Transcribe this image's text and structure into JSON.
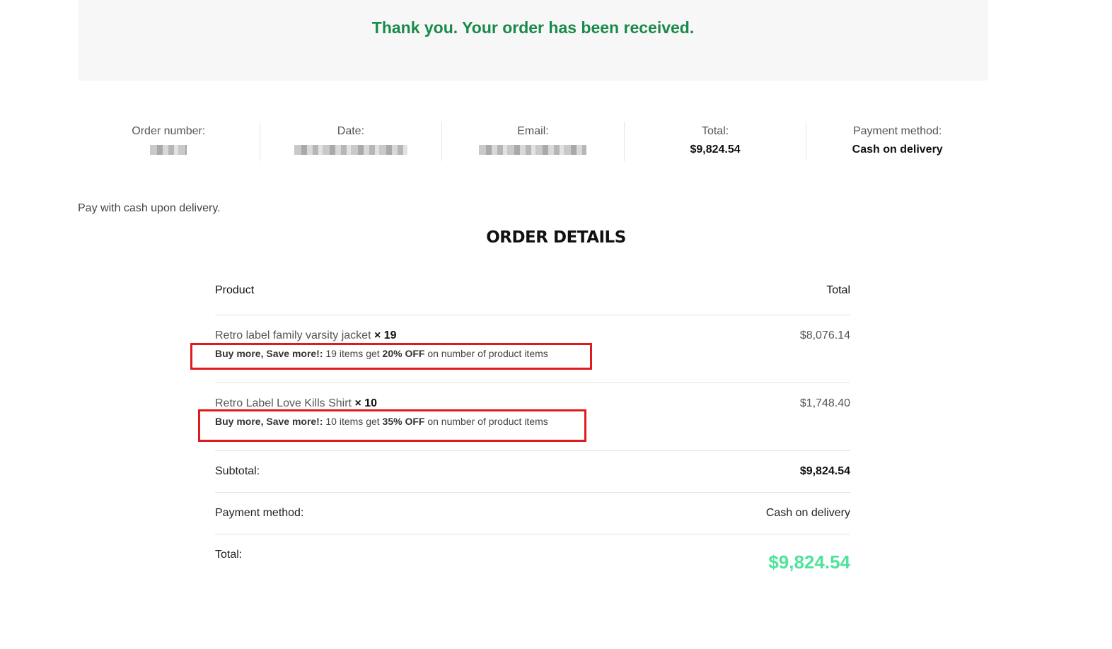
{
  "banner": {
    "message": "Thank you. Your order has been received."
  },
  "overview": {
    "order_number_label": "Order number:",
    "date_label": "Date:",
    "email_label": "Email:",
    "total_label": "Total:",
    "total_value": "$9,824.54",
    "payment_label": "Payment method:",
    "payment_value": "Cash on delivery"
  },
  "pay_note": "Pay with cash upon delivery.",
  "details_heading": "ORDER DETAILS",
  "table": {
    "col_product": "Product",
    "col_total": "Total",
    "items": [
      {
        "name": "Retro label family varsity jacket",
        "qty": "× 19",
        "price": "$8,076.14",
        "promo_label": "Buy more, Save more!:",
        "promo_count": "19 items get",
        "promo_discount": "20% OFF",
        "promo_suffix": "on number of product items"
      },
      {
        "name": "Retro Label Love Kills Shirt",
        "qty": "× 10",
        "price": "$1,748.40",
        "promo_label": "Buy more, Save more!:",
        "promo_count": "10 items get",
        "promo_discount": "35% OFF",
        "promo_suffix": "on number of product items"
      }
    ],
    "subtotal_label": "Subtotal:",
    "subtotal_value": "$9,824.54",
    "payment_label": "Payment method:",
    "payment_value": "Cash on delivery",
    "total_label": "Total:",
    "total_value": "$9,824.54"
  },
  "colors": {
    "banner_text": "#1a8a4a",
    "grand_total": "#4fe39b",
    "annotation": "#e01b1b"
  }
}
